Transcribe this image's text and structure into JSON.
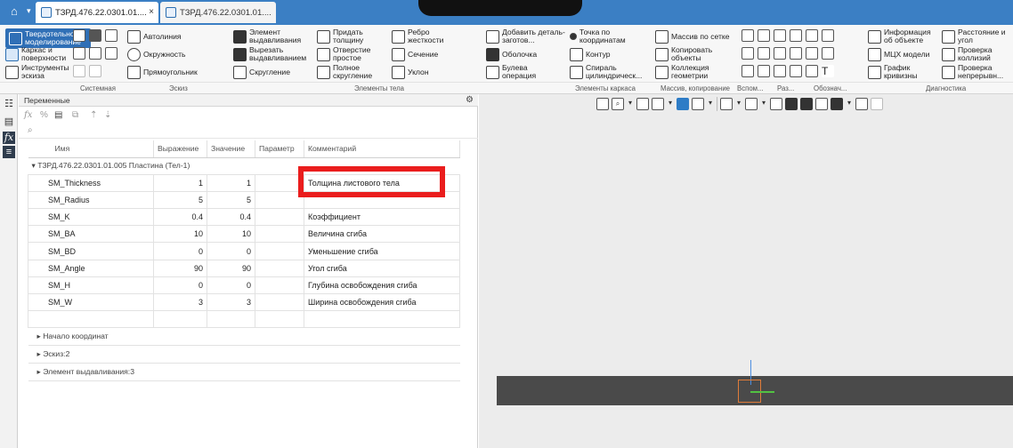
{
  "tabs": [
    {
      "label": "ТЗРД.476.22.0301.01....",
      "close": "×"
    },
    {
      "label": "ТЗРД.476.22.0301.01...."
    }
  ],
  "ribbon": {
    "col1": [
      "Твердотельное моделирование",
      "Каркас и поверхности",
      "Инструменты эскиза"
    ],
    "col2": [
      "Автолиния",
      "Окружность",
      "Прямоугольник"
    ],
    "col3": [
      "Элемент выдавливания",
      "Вырезать выдавливанием",
      "Скругление"
    ],
    "col4": [
      "Придать толщину",
      "Отверстие простое",
      "Полное скругление"
    ],
    "col5": [
      "Ребро жесткости",
      "Сечение",
      "Уклон"
    ],
    "col6": [
      "Добавить деталь-заготов...",
      "Оболочка",
      "Булева операция"
    ],
    "col7": [
      "Точка по координатам",
      "Контур",
      "Спираль цилиндрическ..."
    ],
    "col8": [
      "Массив по сетке",
      "Копировать объекты",
      "Коллекция геометрии"
    ],
    "col9": [
      "Информация об объекте",
      "МЦХ модели",
      "График кривизны"
    ],
    "col10": [
      "Расстояние и угол",
      "Проверка коллизий",
      "Проверка непрерывн..."
    ],
    "sections": [
      "Системная",
      "Эскиз",
      "Элементы тела",
      "Элементы каркаса",
      "Массив, копирование",
      "Вспом...",
      "Раз...",
      "Обознач...",
      "Диагностика"
    ]
  },
  "panel": {
    "title": "Переменные",
    "search_placeholder": "",
    "columns": [
      "Имя",
      "Выражение",
      "Значение",
      "Параметр",
      "Комментарий"
    ],
    "group": "ТЗРД.476.22.0301.01.005 Пластина (Тел-1)",
    "rows": [
      {
        "name": "SM_Thickness",
        "expr": "1",
        "value": "1",
        "param": "",
        "comment": "Толщина листового тела"
      },
      {
        "name": "SM_Radius",
        "expr": "5",
        "value": "5",
        "param": "",
        "comment": ""
      },
      {
        "name": "SM_K",
        "expr": "0.4",
        "value": "0.4",
        "param": "",
        "comment": "Коэффициент"
      },
      {
        "name": "SM_BA",
        "expr": "10",
        "value": "10",
        "param": "",
        "comment": "Величина сгиба"
      },
      {
        "name": "SM_BD",
        "expr": "0",
        "value": "0",
        "param": "",
        "comment": "Уменьшение сгиба"
      },
      {
        "name": "SM_Angle",
        "expr": "90",
        "value": "90",
        "param": "",
        "comment": "Угол сгиба"
      },
      {
        "name": "SM_H",
        "expr": "0",
        "value": "0",
        "param": "",
        "comment": "Глубина освобождения сгиба"
      },
      {
        "name": "SM_W",
        "expr": "3",
        "value": "3",
        "param": "",
        "comment": "Ширина освобождения сгиба"
      }
    ],
    "collapsed": [
      "Начало координат",
      "Эскиз:2",
      "Элемент выдавливания:3"
    ]
  },
  "colors": {
    "accent": "#3b7fc4",
    "highlight": "#ea1d1d",
    "plate": "#4a4a4a"
  }
}
